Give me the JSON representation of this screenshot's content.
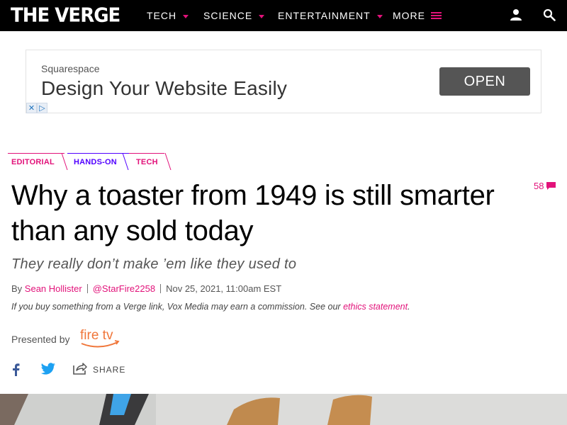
{
  "nav": {
    "logo": "THE VERGE",
    "items": [
      {
        "label": "TECH"
      },
      {
        "label": "SCIENCE"
      },
      {
        "label": "ENTERTAINMENT"
      },
      {
        "label": "MORE"
      }
    ],
    "accent": "#e2127a"
  },
  "ad": {
    "brand": "Squarespace",
    "headline": "Design Your Website Easily",
    "cta": "OPEN",
    "choices": [
      "✕",
      "▷"
    ]
  },
  "breadcrumbs": [
    {
      "label": "EDITORIAL",
      "color": "#e2127a"
    },
    {
      "label": "HANDS-ON",
      "color": "#5200ff"
    },
    {
      "label": "TECH",
      "color": "#e2127a"
    }
  ],
  "article": {
    "comment_count": "58",
    "title": "Why a toaster from 1949 is still smarter than any sold today",
    "subtitle": "They really don’t make ’em like they used to",
    "byline_prefix": "By",
    "author": "Sean Hollister",
    "twitter": "@StarFire2258",
    "date": "Nov 25, 2021, 11:00am EST",
    "disclaimer_text": "If you buy something from a Verge link, Vox Media may earn a commission. See our",
    "disclaimer_link": "ethics statement",
    "disclaimer_end": "."
  },
  "sponsor": {
    "presented_label": "Presented by",
    "brand": "fire tv"
  },
  "share": {
    "label": "SHARE",
    "facebook_color": "#3b5998",
    "twitter_color": "#1da1f2"
  }
}
